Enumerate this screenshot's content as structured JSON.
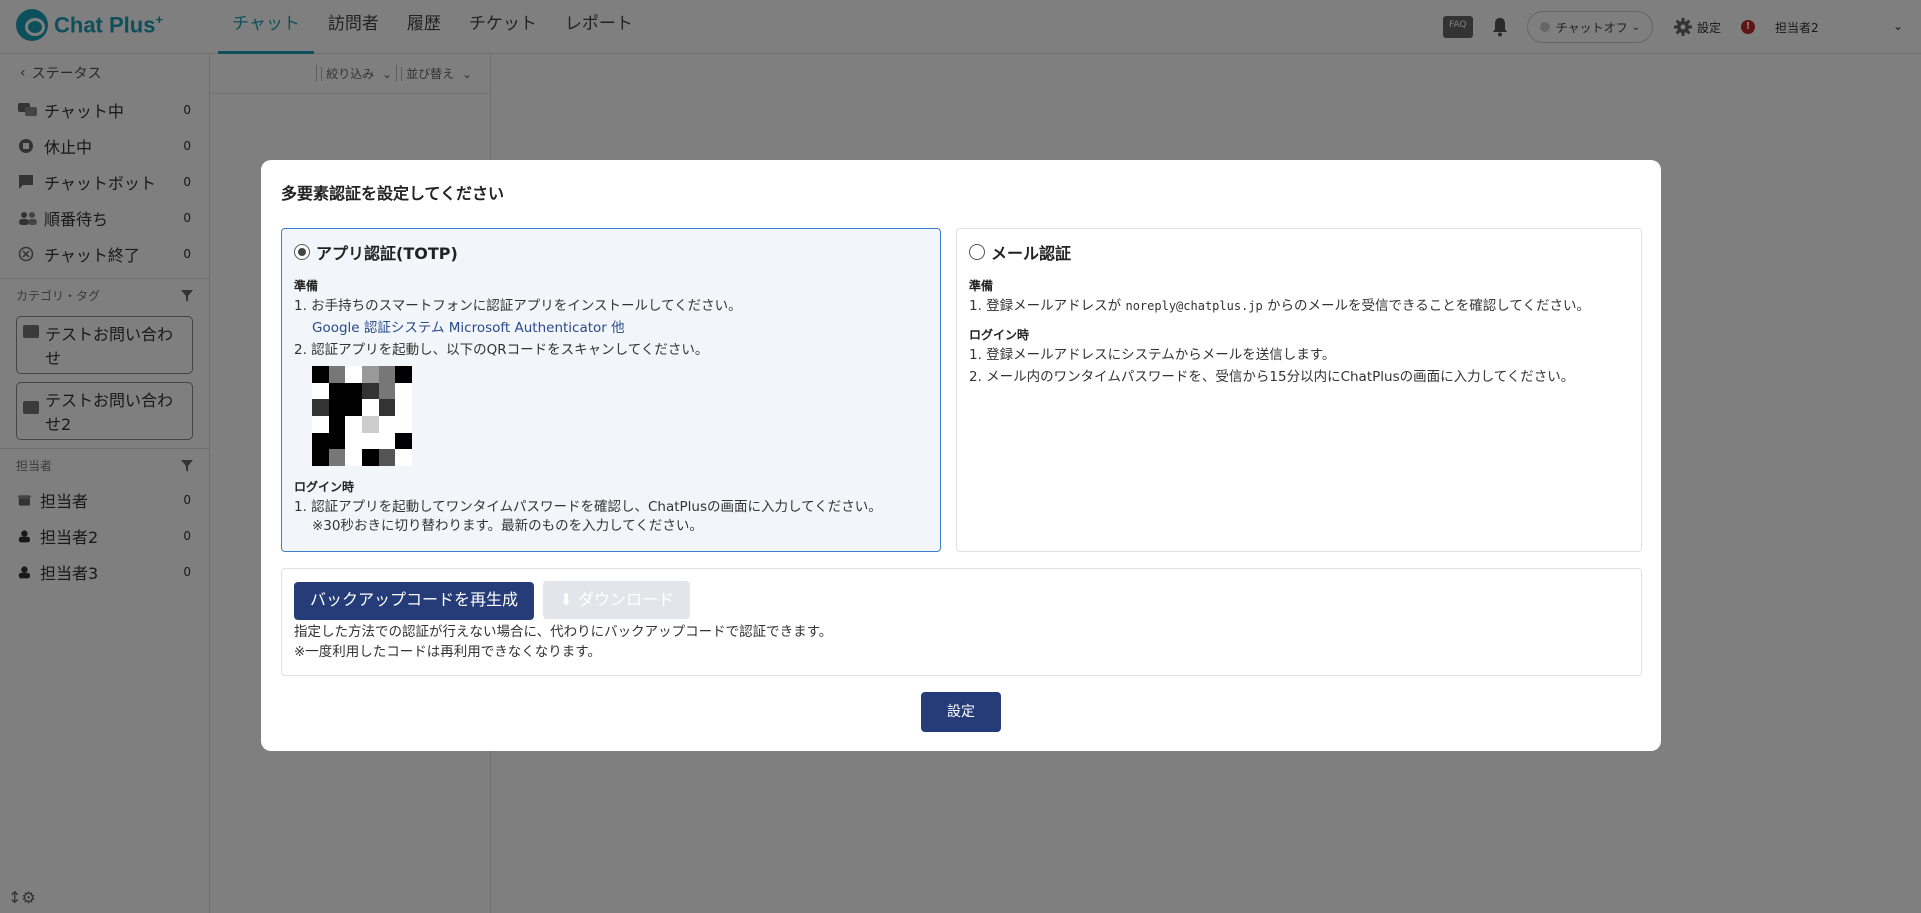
{
  "header": {
    "logo_text": "Chat Plus",
    "logo_plus": "+",
    "nav": [
      "チャット",
      "訪問者",
      "履歴",
      "チケット",
      "レポート"
    ],
    "faq_label": "FAQ",
    "status_label": "チャットオフ",
    "settings_label": "設定",
    "alert_label": "!",
    "user_name": "担当者2"
  },
  "sidebar": {
    "status_header": "ステータス",
    "status_items": [
      {
        "label": "チャット中",
        "count": "0"
      },
      {
        "label": "休止中",
        "count": "0"
      },
      {
        "label": "チャットボット",
        "count": "0"
      },
      {
        "label": "順番待ち",
        "count": "0"
      },
      {
        "label": "チャット終了",
        "count": "0"
      }
    ],
    "category_header": "カテゴリ・タグ",
    "folders": [
      "テストお問い合わせ",
      "テストお問い合わせ2"
    ],
    "agent_header": "担当者",
    "agents": [
      {
        "label": "担当者",
        "count": "0"
      },
      {
        "label": "担当者2",
        "count": "0"
      },
      {
        "label": "担当者3",
        "count": "0"
      }
    ]
  },
  "list": {
    "filter_label": "絞り込み",
    "sort_label": "並び替え"
  },
  "modal": {
    "title": "多要素認証を設定してください",
    "app_option": {
      "title": "アプリ認証(TOTP)",
      "prep_header": "準備",
      "step1": "1. お手持ちのスマートフォンに認証アプリをインストールしてください。",
      "apps": "Google 認証システム Microsoft Authenticator 他",
      "step2": "2.  認証アプリを起動し、以下のQRコードをスキャンしてください。",
      "login_header": "ログイン時",
      "login1": "1. 認証アプリを起動してワンタイムパスワードを確認し、ChatPlusの画面に入力してください。",
      "login_note": "※30秒おきに切り替わります。最新のものを入力してください。"
    },
    "mail_option": {
      "title": "メール認証",
      "prep_header": "準備",
      "step1_pre": "1. 登録メールアドレスが ",
      "email": "noreply@chatplus.jp",
      "step1_post": " からのメールを受信できることを確認してください。",
      "login_header": "ログイン時",
      "login1": "1. 登録メールアドレスにシステムからメールを送信します。",
      "login2": "2. メール内のワンタイムパスワードを、受信から15分以内にChatPlusの画面に入力してください。"
    },
    "backup": {
      "regen_button": "バックアップコードを再生成",
      "download_button": "ダウンロード",
      "note1": "指定した方法での認証が行えない場合に、代わりにバックアップコードで認証できます。",
      "note2": "※一度利用したコードは再利用できなくなります。"
    },
    "submit_button": "設定"
  },
  "colors": {
    "brand": "#1ba1b8",
    "primary_button": "#253c78",
    "selected_border": "#3b7fd1"
  }
}
